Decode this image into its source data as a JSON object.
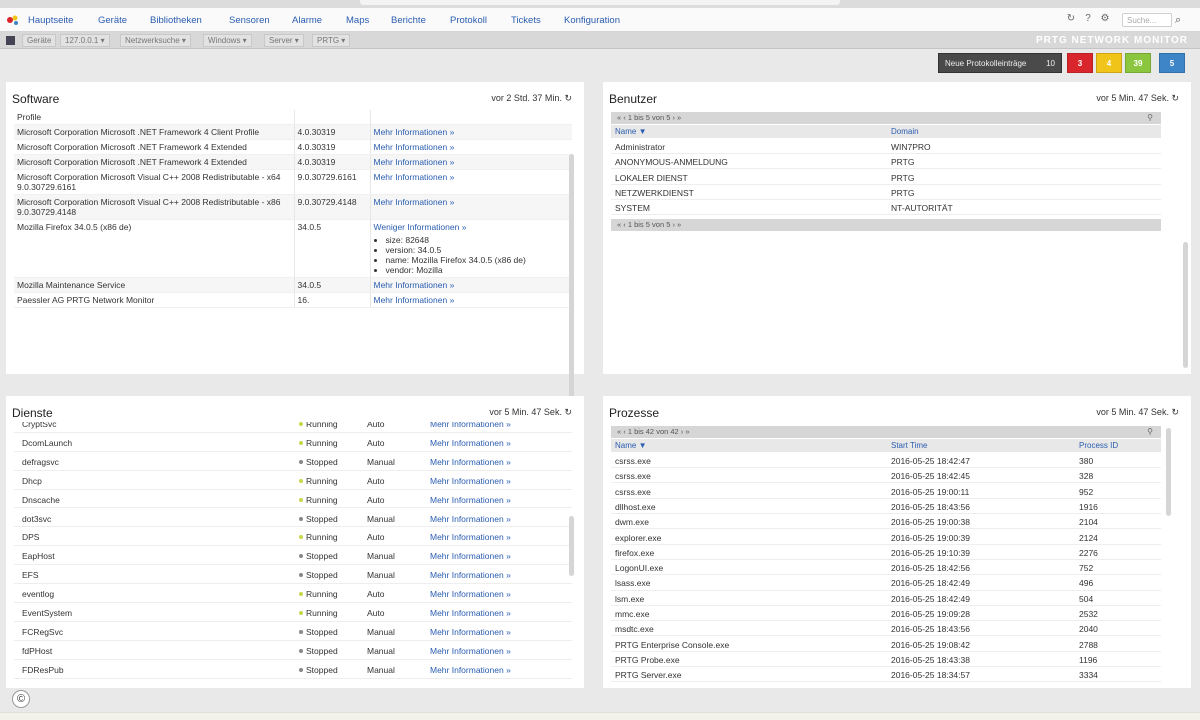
{
  "menu": {
    "items": [
      "Hauptseite",
      "Geräte",
      "Bibliotheken",
      "Sensoren",
      "Alarme",
      "Maps",
      "Berichte",
      "Protokoll",
      "Tickets",
      "Konfiguration"
    ],
    "search_placeholder": "Suche..."
  },
  "breadcrumbs": [
    "Geräte",
    "127.0.0.1 ▾",
    "Netzwerksuche ▾",
    "Windows ▾",
    "Server ▾",
    "PRTG ▾"
  ],
  "brand": "PRTG NETWORK MONITOR",
  "status": {
    "log_button": "Neue Protokolleinträge",
    "log_count": "10",
    "badges": [
      {
        "label": "3",
        "color": "#d9262c"
      },
      {
        "label": "4",
        "color": "#f0c419"
      },
      {
        "label": "39",
        "color": "#8cc63f"
      },
      {
        "label": "5",
        "color": "#3d85c6"
      }
    ]
  },
  "software": {
    "title": "Software",
    "time": "vor 2 Std. 37 Min.",
    "rows": [
      {
        "name": "Profile",
        "version": "",
        "info": ""
      },
      {
        "name": "Microsoft Corporation Microsoft .NET Framework 4 Client Profile",
        "version": "4.0.30319",
        "info": "Mehr Informationen »"
      },
      {
        "name": "Microsoft Corporation Microsoft .NET Framework 4 Extended",
        "version": "4.0.30319",
        "info": "Mehr Informationen »"
      },
      {
        "name": "Microsoft Corporation Microsoft .NET Framework 4 Extended",
        "version": "4.0.30319",
        "info": "Mehr Informationen »"
      },
      {
        "name": "Microsoft Corporation Microsoft Visual C++ 2008 Redistributable - x64 9.0.30729.6161",
        "version": "9.0.30729.6161",
        "info": "Mehr Informationen »"
      },
      {
        "name": "Microsoft Corporation Microsoft Visual C++ 2008 Redistributable - x86 9.0.30729.4148",
        "version": "9.0.30729.4148",
        "info": "Mehr Informationen »"
      },
      {
        "name": "Mozilla Firefox 34.0.5 (x86 de)",
        "version": "34.0.5",
        "info": "Weniger Informationen »",
        "details": [
          "size: 82648",
          "version: 34.0.5",
          "name: Mozilla Firefox 34.0.5 (x86 de)",
          "vendor: Mozilla"
        ]
      },
      {
        "name": "Mozilla Maintenance Service",
        "version": "34.0.5",
        "info": "Mehr Informationen »"
      },
      {
        "name": "Paessler AG PRTG Network Monitor",
        "version": "16.",
        "info": "Mehr Informationen »"
      }
    ]
  },
  "users": {
    "title": "Benutzer",
    "time": "vor 5 Min. 47 Sek.",
    "pager": "« ‹ 1 bis 5 von 5 › »",
    "col_name": "Name ▼",
    "col_domain": "Domain",
    "rows": [
      {
        "name": "Administrator",
        "domain": "WIN7PRO"
      },
      {
        "name": "ANONYMOUS-ANMELDUNG",
        "domain": "PRTG"
      },
      {
        "name": "LOKALER DIENST",
        "domain": "PRTG"
      },
      {
        "name": "NETZWERKDIENST",
        "domain": "PRTG"
      },
      {
        "name": "SYSTEM",
        "domain": "NT-AUTORITÄT"
      }
    ]
  },
  "services": {
    "title": "Dienste",
    "time": "vor 5 Min. 47 Sek.",
    "rows": [
      {
        "name": "CryptSvc",
        "status": "Running",
        "start": "Auto",
        "info": "Mehr Informationen »"
      },
      {
        "name": "DcomLaunch",
        "status": "Running",
        "start": "Auto",
        "info": "Mehr Informationen »"
      },
      {
        "name": "defragsvc",
        "status": "Stopped",
        "start": "Manual",
        "info": "Mehr Informationen »"
      },
      {
        "name": "Dhcp",
        "status": "Running",
        "start": "Auto",
        "info": "Mehr Informationen »"
      },
      {
        "name": "Dnscache",
        "status": "Running",
        "start": "Auto",
        "info": "Mehr Informationen »"
      },
      {
        "name": "dot3svc",
        "status": "Stopped",
        "start": "Manual",
        "info": "Mehr Informationen »"
      },
      {
        "name": "DPS",
        "status": "Running",
        "start": "Auto",
        "info": "Mehr Informationen »"
      },
      {
        "name": "EapHost",
        "status": "Stopped",
        "start": "Manual",
        "info": "Mehr Informationen »"
      },
      {
        "name": "EFS",
        "status": "Stopped",
        "start": "Manual",
        "info": "Mehr Informationen »"
      },
      {
        "name": "eventlog",
        "status": "Running",
        "start": "Auto",
        "info": "Mehr Informationen »"
      },
      {
        "name": "EventSystem",
        "status": "Running",
        "start": "Auto",
        "info": "Mehr Informationen »"
      },
      {
        "name": "FCRegSvc",
        "status": "Stopped",
        "start": "Manual",
        "info": "Mehr Informationen »"
      },
      {
        "name": "fdPHost",
        "status": "Stopped",
        "start": "Manual",
        "info": "Mehr Informationen »"
      },
      {
        "name": "FDResPub",
        "status": "Stopped",
        "start": "Manual",
        "info": "Mehr Informationen »"
      }
    ]
  },
  "processes": {
    "title": "Prozesse",
    "time": "vor 5 Min. 47 Sek.",
    "pager": "« ‹ 1 bis 42 von 42 › »",
    "col_name": "Name ▼",
    "col_start": "Start Time",
    "col_pid": "Process ID",
    "rows": [
      {
        "name": "csrss.exe",
        "start": "2016-05-25 18:42:47",
        "pid": "380"
      },
      {
        "name": "csrss.exe",
        "start": "2016-05-25 18:42:45",
        "pid": "328"
      },
      {
        "name": "csrss.exe",
        "start": "2016-05-25 19:00:11",
        "pid": "952"
      },
      {
        "name": "dllhost.exe",
        "start": "2016-05-25 18:43:56",
        "pid": "1916"
      },
      {
        "name": "dwm.exe",
        "start": "2016-05-25 19:00:38",
        "pid": "2104"
      },
      {
        "name": "explorer.exe",
        "start": "2016-05-25 19:00:39",
        "pid": "2124"
      },
      {
        "name": "firefox.exe",
        "start": "2016-05-25 19:10:39",
        "pid": "2276"
      },
      {
        "name": "LogonUI.exe",
        "start": "2016-05-25 18:42:56",
        "pid": "752"
      },
      {
        "name": "lsass.exe",
        "start": "2016-05-25 18:42:49",
        "pid": "496"
      },
      {
        "name": "lsm.exe",
        "start": "2016-05-25 18:42:49",
        "pid": "504"
      },
      {
        "name": "mmc.exe",
        "start": "2016-05-25 19:09:28",
        "pid": "2532"
      },
      {
        "name": "msdtc.exe",
        "start": "2016-05-25 18:43:56",
        "pid": "2040"
      },
      {
        "name": "PRTG Enterprise Console.exe",
        "start": "2016-05-25 19:08:42",
        "pid": "2788"
      },
      {
        "name": "PRTG Probe.exe",
        "start": "2016-05-25 18:43:38",
        "pid": "1196"
      },
      {
        "name": "PRTG Server.exe",
        "start": "2016-05-25 18:34:57",
        "pid": "3334"
      }
    ]
  }
}
